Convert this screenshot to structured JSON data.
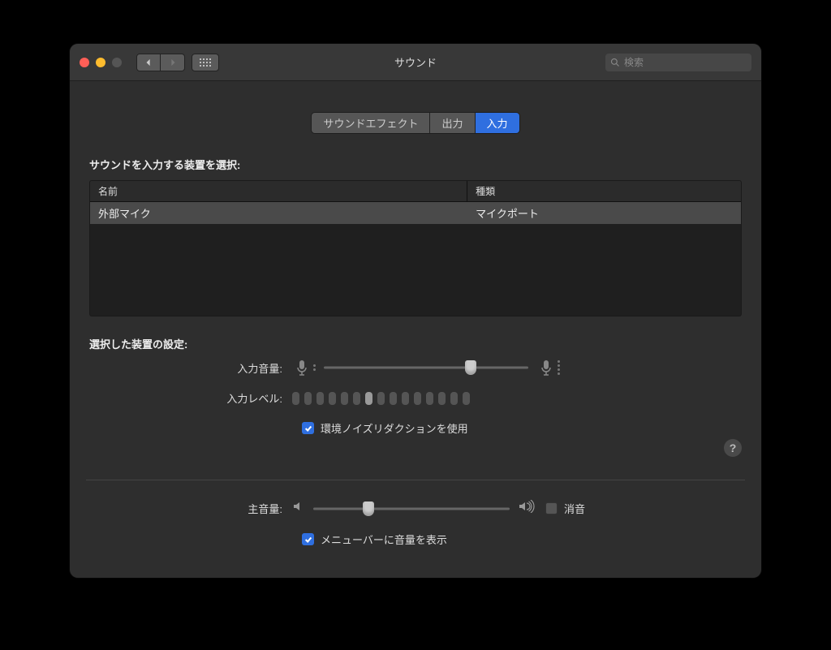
{
  "window": {
    "title": "サウンド"
  },
  "search": {
    "placeholder": "検索"
  },
  "tabs": {
    "items": [
      "サウンドエフェクト",
      "出力",
      "入力"
    ],
    "activeIndex": 2
  },
  "input": {
    "select_label": "サウンドを入力する装置を選択:",
    "columns": {
      "name": "名前",
      "type": "種類"
    },
    "devices": [
      {
        "name": "外部マイク",
        "type": "マイクポート"
      }
    ],
    "settings_label": "選択した装置の設定:",
    "input_volume_label": "入力音量:",
    "input_volume_percent": 72,
    "input_level_label": "入力レベル:",
    "input_level_active": 7,
    "input_level_total": 15,
    "noise_reduction_label": "環境ノイズリダクションを使用",
    "noise_reduction_checked": true
  },
  "output": {
    "main_volume_label": "主音量:",
    "main_volume_percent": 28,
    "mute_label": "消音",
    "mute_checked": false,
    "show_menubar_label": "メニューバーに音量を表示",
    "show_menubar_checked": true
  }
}
